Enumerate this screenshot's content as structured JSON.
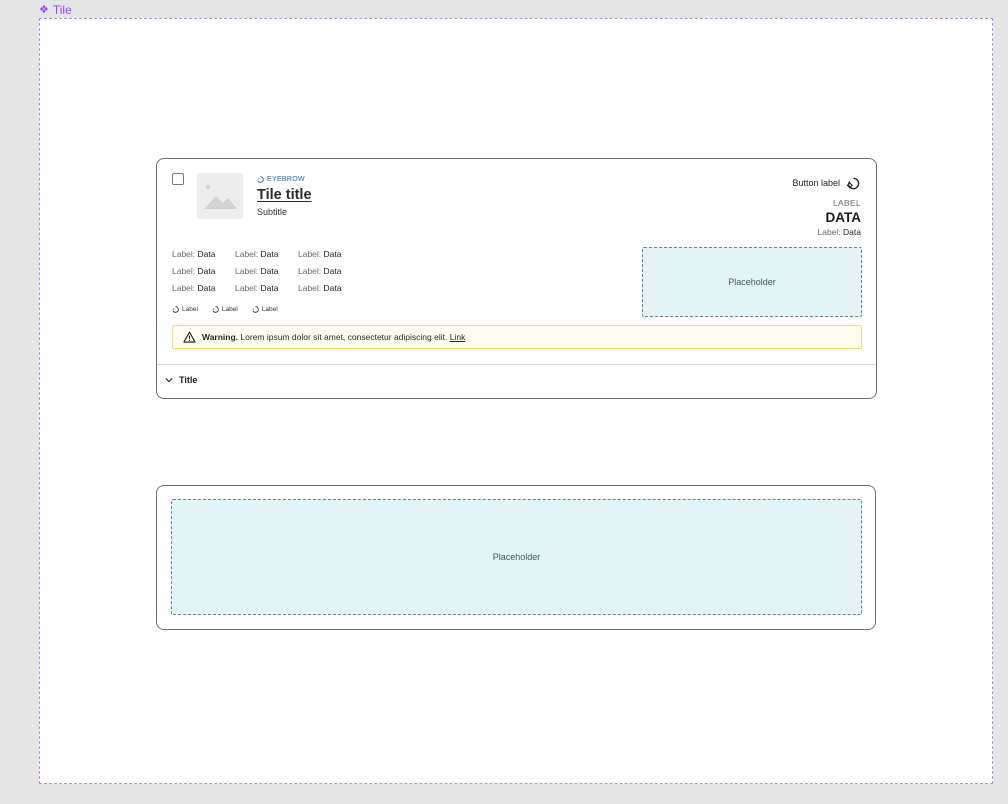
{
  "frame": {
    "label": "Tile",
    "icon": "component-icon",
    "accent": "#9747ff"
  },
  "tile": {
    "eyebrow": "EYEBROW",
    "title": "Tile title",
    "subtitle": "Subtitle",
    "button_label": "Button label",
    "label_upper": "LABEL",
    "data_big": "DATA",
    "small_label": "Label:",
    "small_data": "Data",
    "data_rows": [
      [
        {
          "label": "Label:",
          "value": "Data"
        },
        {
          "label": "Label:",
          "value": "Data"
        },
        {
          "label": "Label:",
          "value": "Data"
        }
      ],
      [
        {
          "label": "Label:",
          "value": "Data"
        },
        {
          "label": "Label:",
          "value": "Data"
        },
        {
          "label": "Label:",
          "value": "Data"
        }
      ],
      [
        {
          "label": "Label:",
          "value": "Data"
        },
        {
          "label": "Label:",
          "value": "Data"
        },
        {
          "label": "Label:",
          "value": "Data"
        }
      ]
    ],
    "tags": [
      "Label",
      "Label",
      "Label"
    ],
    "placeholder": "Placeholder",
    "warning": {
      "strong": "Warning.",
      "text": "Lorem ipsum dolor sit amet, consectetur adipiscing elit.",
      "link": "Link",
      "bg_color": "#fffbee",
      "border_color": "#f4d68c"
    },
    "accordion_title": "Title"
  },
  "tile2": {
    "placeholder": "Placeholder"
  },
  "colors": {
    "placeholder_bg": "#e4f3f3",
    "placeholder_border": "#5e8a95",
    "eyebrow": "#2b66b3"
  }
}
